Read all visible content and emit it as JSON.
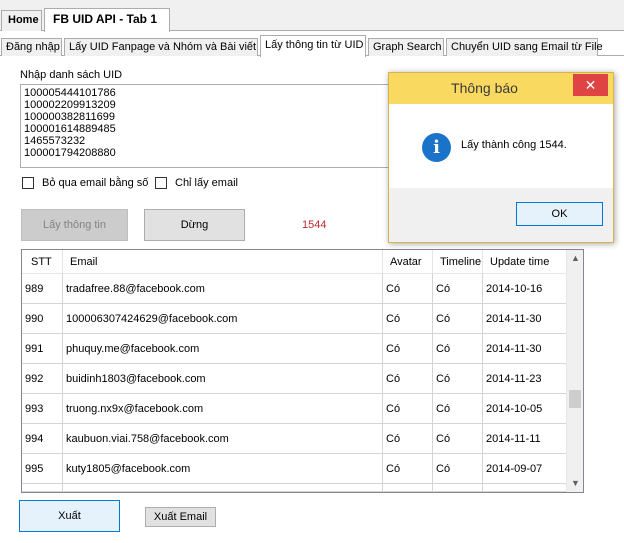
{
  "top_tabs": [
    {
      "label": "Home"
    },
    {
      "label": "FB UID API - Tab 1"
    }
  ],
  "inner_tabs": [
    {
      "label": "Đăng nhập"
    },
    {
      "label": "Lấy UID Fanpage và Nhóm và Bài viết"
    },
    {
      "label": "Lấy thông tin từ UID"
    },
    {
      "label": "Graph Search"
    },
    {
      "label": "Chuyển UID sang Email từ File"
    }
  ],
  "uid_section": {
    "label": "Nhập danh sách UID",
    "lines": [
      "100005444101786",
      "100002209913209",
      "100000382811699",
      "100001614889485",
      "1465573232",
      "100001794208880"
    ]
  },
  "options": {
    "skip_digit_email": "Bỏ qua email bằng số",
    "email_only": "Chỉ lấy email"
  },
  "buttons": {
    "get_info": "Lấy thông tin",
    "stop": "Dừng",
    "export": "Xuất",
    "export_email": "Xuất Email"
  },
  "result_count": "1544",
  "grid": {
    "columns": [
      "STT",
      "Email",
      "Avatar",
      "Timeline",
      "Update time"
    ],
    "rows": [
      [
        "989",
        "tradafree.88@facebook.com",
        "Có",
        "Có",
        "2014-10-16"
      ],
      [
        "990",
        "100006307424629@facebook.com",
        "Có",
        "Có",
        "2014-11-30"
      ],
      [
        "991",
        "phuquy.me@facebook.com",
        "Có",
        "Có",
        "2014-11-30"
      ],
      [
        "992",
        "buidinh1803@facebook.com",
        "Có",
        "Có",
        "2014-11-23"
      ],
      [
        "993",
        "truong.nx9x@facebook.com",
        "Có",
        "Có",
        "2014-10-05"
      ],
      [
        "994",
        "kaubuon.viai.758@facebook.com",
        "Có",
        "Có",
        "2014-11-11"
      ],
      [
        "995",
        "kuty1805@facebook.com",
        "Có",
        "Có",
        "2014-09-07"
      ]
    ]
  },
  "dialog": {
    "title": "Thông báo",
    "message": "Lấy thành công 1544.",
    "ok": "OK",
    "close": "✕",
    "icon": "info-icon"
  },
  "colors": {
    "dialog_title_bg": "#fad961",
    "close_button": "#e04343",
    "count_text": "#c0282d",
    "info_icon": "#1a73c9"
  }
}
